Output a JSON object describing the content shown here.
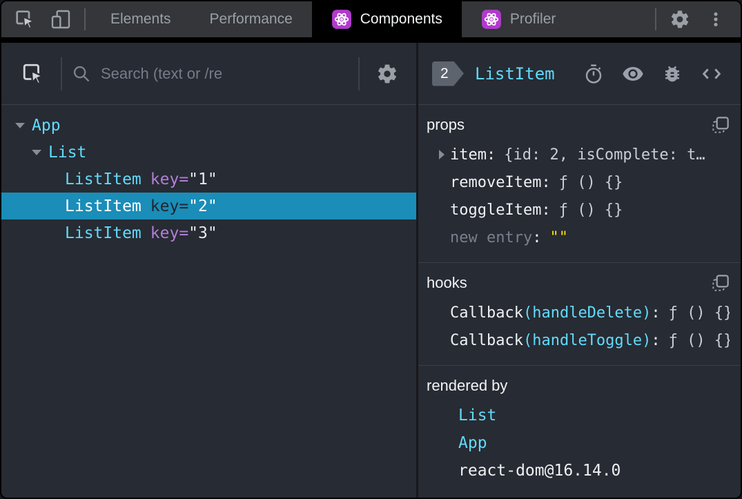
{
  "tabs": {
    "elements": "Elements",
    "performance": "Performance",
    "components": "Components",
    "profiler": "Profiler"
  },
  "left": {
    "toolbar": {
      "search_placeholder": "Search (text or /re"
    },
    "tree": [
      {
        "label": "App"
      },
      {
        "label": "List"
      },
      {
        "label": "ListItem",
        "key_name": "key=",
        "key_value": "\"1\""
      },
      {
        "label": "ListItem",
        "key_name": "key=",
        "key_value": "\"2\"",
        "selected": true
      },
      {
        "label": "ListItem",
        "key_name": "key=",
        "key_value": "\"3\""
      }
    ]
  },
  "right": {
    "header": {
      "badge": "2",
      "component": "ListItem"
    },
    "props": {
      "title": "props",
      "rows": [
        {
          "name": "item",
          "value": "{id: 2, isComplete: t…"
        },
        {
          "name": "removeItem",
          "value": "ƒ () {}"
        },
        {
          "name": "toggleItem",
          "value": "ƒ () {}"
        },
        {
          "name": "new entry",
          "value": "\"\""
        }
      ]
    },
    "hooks": {
      "title": "hooks",
      "rows": [
        {
          "name": "Callback",
          "hook": "(handleDelete)",
          "value": "ƒ () {}"
        },
        {
          "name": "Callback",
          "hook": "(handleToggle)",
          "value": "ƒ () {}"
        }
      ]
    },
    "rendered_by": {
      "title": "rendered by",
      "items": [
        "List",
        "App",
        "react-dom@16.14.0"
      ]
    }
  },
  "punct": {
    "colon": ":"
  },
  "colors": {
    "component_cyan": "#61dafb",
    "selected_row_blue": "#1a8db8",
    "react_icon_purple": "#b23ace",
    "string_yellow": "#ffdf00",
    "key_purple": "#b47ed8",
    "panel_background": "#272b33",
    "tabbar_background": "#343639",
    "active_tab_background": "#000000"
  }
}
